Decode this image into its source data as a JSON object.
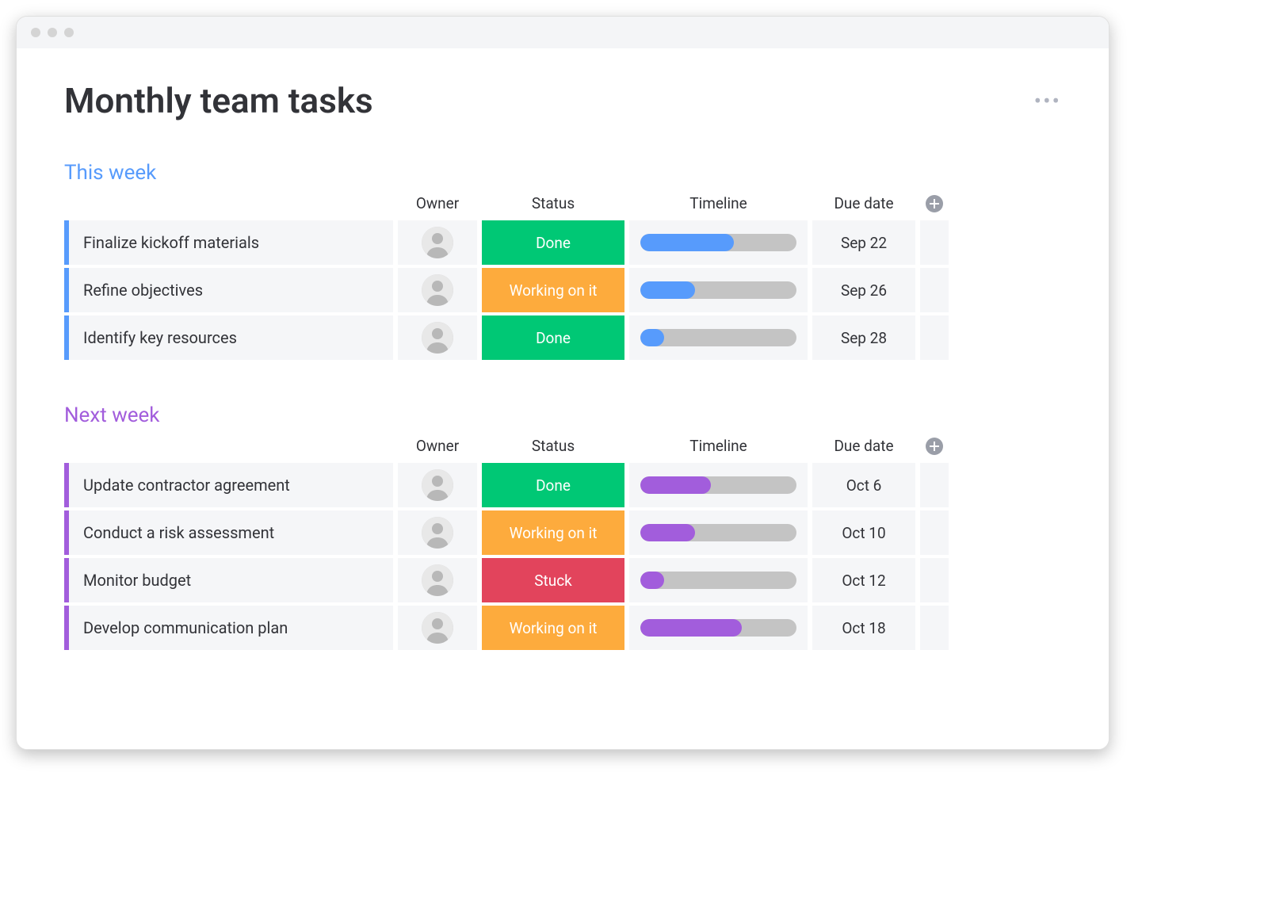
{
  "board": {
    "title": "Monthly team tasks"
  },
  "columns": {
    "task": "",
    "owner": "Owner",
    "status": "Status",
    "timeline": "Timeline",
    "due": "Due date"
  },
  "status_colors": {
    "Done": "#00c875",
    "Working on it": "#fdab3d",
    "Stuck": "#e2445c"
  },
  "groups": [
    {
      "name": "This week",
      "color": "#579bfc",
      "rows": [
        {
          "task": "Finalize kickoff materials",
          "owner": "avatar-1",
          "status": "Done",
          "progress": 60,
          "due": "Sep 22"
        },
        {
          "task": "Refine objectives",
          "owner": "avatar-2",
          "status": "Working on it",
          "progress": 35,
          "due": "Sep 26"
        },
        {
          "task": "Identify key resources",
          "owner": "avatar-3",
          "status": "Done",
          "progress": 15,
          "due": "Sep 28"
        }
      ]
    },
    {
      "name": "Next week",
      "color": "#a25ddc",
      "rows": [
        {
          "task": "Update contractor agreement",
          "owner": "avatar-4",
          "status": "Done",
          "progress": 45,
          "due": "Oct 6"
        },
        {
          "task": "Conduct a risk assessment",
          "owner": "avatar-2",
          "status": "Working on it",
          "progress": 35,
          "due": "Oct 10"
        },
        {
          "task": "Monitor budget",
          "owner": "avatar-5",
          "status": "Stuck",
          "progress": 15,
          "due": "Oct 12"
        },
        {
          "task": "Develop communication plan",
          "owner": "avatar-6",
          "status": "Working on it",
          "progress": 65,
          "due": "Oct 18"
        }
      ]
    }
  ]
}
